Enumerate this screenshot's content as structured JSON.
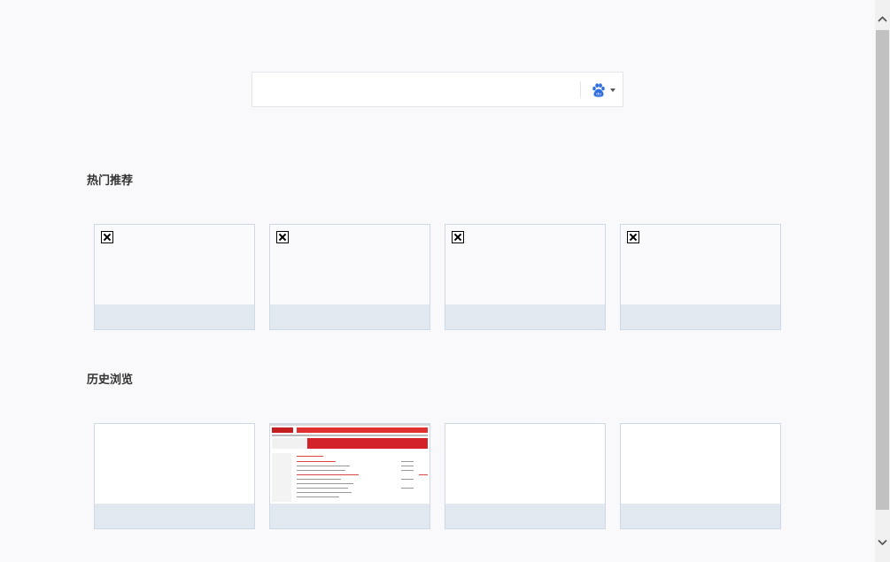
{
  "search": {
    "value": "",
    "placeholder": "",
    "engine": "baidu-paw-icon"
  },
  "sections": {
    "popular": {
      "title": "热门推荐",
      "tiles": [
        {
          "caption": "",
          "thumb": "broken-image-icon"
        },
        {
          "caption": "",
          "thumb": "broken-image-icon"
        },
        {
          "caption": "",
          "thumb": "broken-image-icon"
        },
        {
          "caption": "",
          "thumb": "broken-image-icon"
        }
      ]
    },
    "history": {
      "title": "历史浏览",
      "tiles": [
        {
          "caption": "",
          "thumb": "blank"
        },
        {
          "caption": "",
          "thumb": "website-screenshot"
        },
        {
          "caption": "",
          "thumb": "blank"
        },
        {
          "caption": "",
          "thumb": "blank"
        }
      ]
    }
  },
  "colors": {
    "background": "#f9f9fb",
    "tile_caption_bg": "#e2e8f0",
    "tile_border": "#cfd8e6",
    "baidu_blue": "#2f6fde"
  }
}
